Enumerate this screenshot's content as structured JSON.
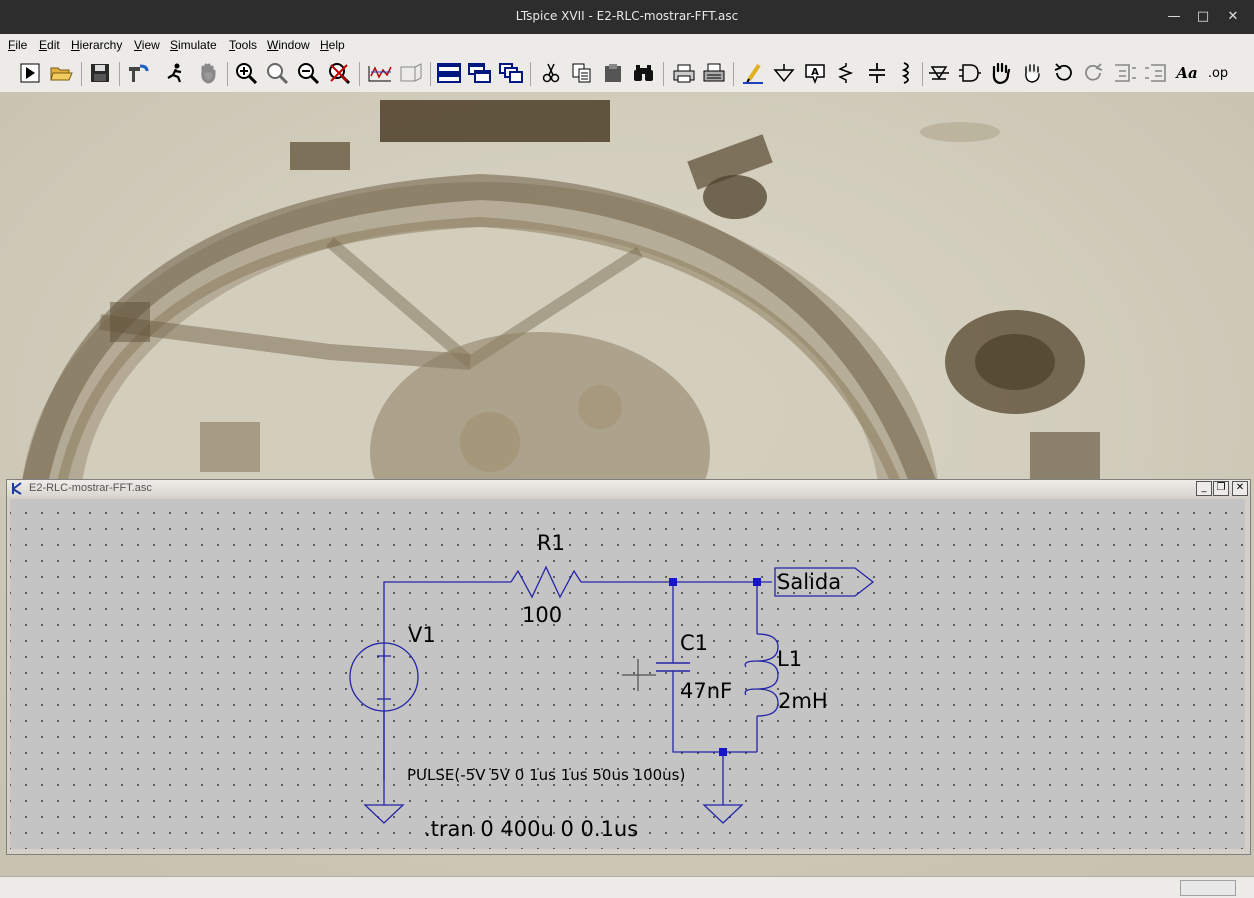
{
  "window": {
    "title": "LTspice XVII - E2-RLC-mostrar-FFT.asc"
  },
  "menu": [
    {
      "u": "F",
      "rest": "ile"
    },
    {
      "u": "E",
      "rest": "dit"
    },
    {
      "u": "H",
      "rest": "ierarchy"
    },
    {
      "u": "V",
      "rest": "iew"
    },
    {
      "u": "S",
      "rest": "imulate"
    },
    {
      "u": "T",
      "rest": "ools"
    },
    {
      "u": "W",
      "rest": "indow"
    },
    {
      "u": "H",
      "rest": "elp"
    }
  ],
  "toolbar": {
    "text_tool_label": "Aa",
    "spice_directive_label": ".op",
    "icons": [
      "run",
      "open",
      "save",
      "control-panel",
      "halt",
      "pan",
      "zoom-in",
      "zoom-fit",
      "zoom-out",
      "zoom-cancel",
      "waveform-autorange",
      "waveform-shrink",
      "tile-horizontal",
      "tile-vertical",
      "cascade",
      "cut",
      "copy",
      "paste",
      "find",
      "print",
      "print-setup",
      "draw-wire",
      "ground",
      "label-net",
      "resistor",
      "capacitor",
      "inductor",
      "diode",
      "component",
      "move",
      "drag",
      "undo",
      "redo",
      "rotate",
      "mirror",
      "text",
      "spice-directive"
    ]
  },
  "schematic": {
    "tab_title": "E2-RLC-mostrar-FFT.asc",
    "components": {
      "r1_name": "R1",
      "r1_value": "100",
      "v1_name": "V1",
      "v1_value": "PULSE(-5V 5V 0 1us 1us 50us 100us)",
      "c1_name": "C1",
      "c1_value": "47nF",
      "l1_name": "L1",
      "l1_value": "2mH",
      "net_label": "Salida"
    },
    "directive": ".tran 0 400u 0 0.1us"
  },
  "colors": {
    "wire": "#2525a8",
    "junction": "#1616c8",
    "schematic_bg": "#c4c4c4",
    "titlebar": "#2d2d2d"
  }
}
